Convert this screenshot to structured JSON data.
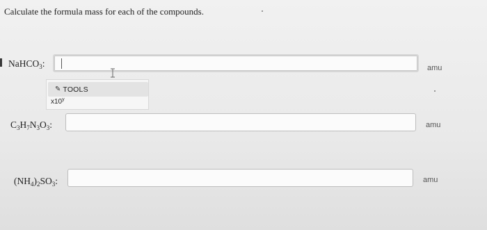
{
  "instruction": "Calculate the formula mass for each of the compounds.",
  "compounds": [
    {
      "name": "NaHCO3",
      "parts": [
        {
          "t": "NaHCO"
        },
        {
          "sub": "3"
        },
        {
          "t": ":"
        }
      ],
      "value": "",
      "unit": "amu"
    },
    {
      "name": "C3H7N3O3",
      "parts": [
        {
          "t": "C"
        },
        {
          "sub": "3"
        },
        {
          "t": "H"
        },
        {
          "sub": "7"
        },
        {
          "t": "N"
        },
        {
          "sub": "3"
        },
        {
          "t": "O"
        },
        {
          "sub": "3"
        },
        {
          "t": ":"
        }
      ],
      "value": "",
      "unit": "amu"
    },
    {
      "name": "(NH4)2SO3",
      "parts": [
        {
          "t": "(NH"
        },
        {
          "sub": "4"
        },
        {
          "t": ")"
        },
        {
          "sub": "2"
        },
        {
          "t": "SO"
        },
        {
          "sub": "3"
        },
        {
          "t": ":"
        }
      ],
      "value": "",
      "unit": "amu"
    }
  ],
  "tools": {
    "label": "TOOLS",
    "pencil_icon": "pencil-icon",
    "x10_base": "x10",
    "x10_exp": "y"
  }
}
